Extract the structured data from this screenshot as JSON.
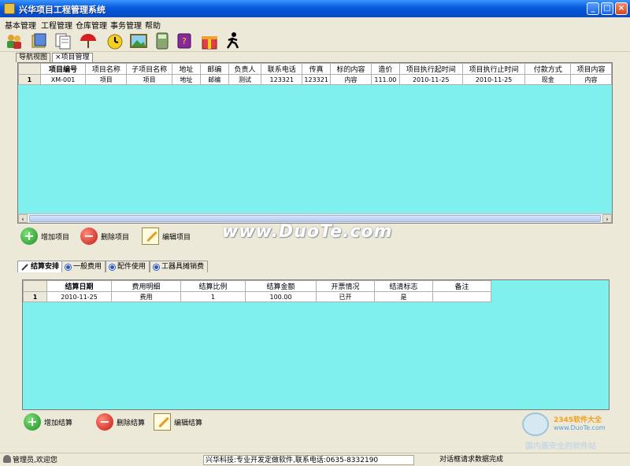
{
  "window": {
    "title": "兴华项目工程管理系统",
    "controls": {
      "minimize": "_",
      "maximize": "□",
      "close": "×"
    }
  },
  "menu": [
    "基本管理",
    "工程管理",
    "仓库管理",
    "事务管理",
    "帮助"
  ],
  "toolbar_icons": [
    "users-icon",
    "books-icon",
    "documents-icon",
    "umbrella-icon",
    "clock-icon",
    "landscape-picture-icon",
    "calculator-icon",
    "book-icon",
    "gift-icon",
    "running-man-icon"
  ],
  "nav_tabs": [
    "导航视图",
    "项目管理"
  ],
  "nav_tab_close": "×",
  "project_table": {
    "columns": [
      "项目编号",
      "项目名称",
      "子项目名称",
      "地址",
      "邮编",
      "负责人",
      "联系电话",
      "传真",
      "标的内容",
      "造价",
      "项目执行起时间",
      "项目执行止时间",
      "付款方式",
      "项目内容"
    ],
    "rows": [
      {
        "num": "1",
        "cells": [
          "XM-001",
          "项目",
          "项目",
          "地址",
          "邮编",
          "测试",
          "123321",
          "123321",
          "内容",
          "111.00",
          "2010-11-25",
          "2010-11-25",
          "现金",
          "内容"
        ]
      }
    ],
    "scroll": {
      "left": "‹",
      "right": "›"
    }
  },
  "project_actions": {
    "add": "增加项目",
    "delete": "删除项目",
    "edit": "编辑项目"
  },
  "watermark": "www.DuoTe.com",
  "lower_tabs": [
    "结算安排",
    "一般费用",
    "配件使用",
    "工器具摊销费"
  ],
  "settlement_table": {
    "columns": [
      "结算日期",
      "费用明细",
      "结算比例",
      "结算金额",
      "开票情况",
      "结清标志",
      "备注"
    ],
    "rows": [
      {
        "num": "1",
        "cells": [
          "2010-11-25",
          "费用",
          "1",
          "100.00",
          "已开",
          "是",
          ""
        ]
      }
    ]
  },
  "settlement_actions": {
    "add": "增加结算",
    "delete": "删除结算",
    "edit": "编辑结算"
  },
  "logo": {
    "brand": "2345软件大全",
    "url": "www.DuoTe.com",
    "slogan": "国内最安全的软件站"
  },
  "status": {
    "user": "管理员,欢迎您",
    "company": "兴华科技:专业开发定做软件,联系电话:0635-8332190",
    "message": "对话框请求数据完成"
  },
  "colors": {
    "grid_background": "#7ff0ee",
    "titlebar": "#0a5fe0"
  }
}
